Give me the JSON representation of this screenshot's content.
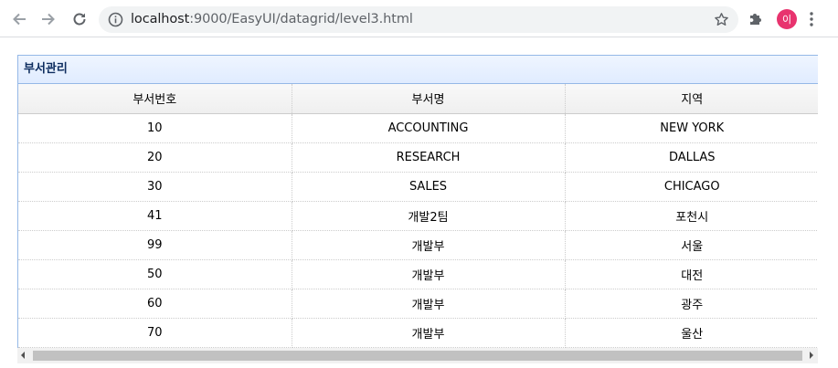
{
  "browser": {
    "url_host": "localhost",
    "url_rest": ":9000/EasyUI/datagrid/level3.html",
    "profile_initial": "이"
  },
  "panel": {
    "title": "부서관리"
  },
  "grid": {
    "columns": [
      "부서번호",
      "부서명",
      "지역"
    ],
    "rows": [
      [
        "10",
        "ACCOUNTING",
        "NEW YORK"
      ],
      [
        "20",
        "RESEARCH",
        "DALLAS"
      ],
      [
        "30",
        "SALES",
        "CHICAGO"
      ],
      [
        "41",
        "개발2팀",
        "포천시"
      ],
      [
        "99",
        "개발부",
        "서울"
      ],
      [
        "50",
        "개발부",
        "대전"
      ],
      [
        "60",
        "개발부",
        "광주"
      ],
      [
        "70",
        "개발부",
        "울산"
      ]
    ]
  }
}
